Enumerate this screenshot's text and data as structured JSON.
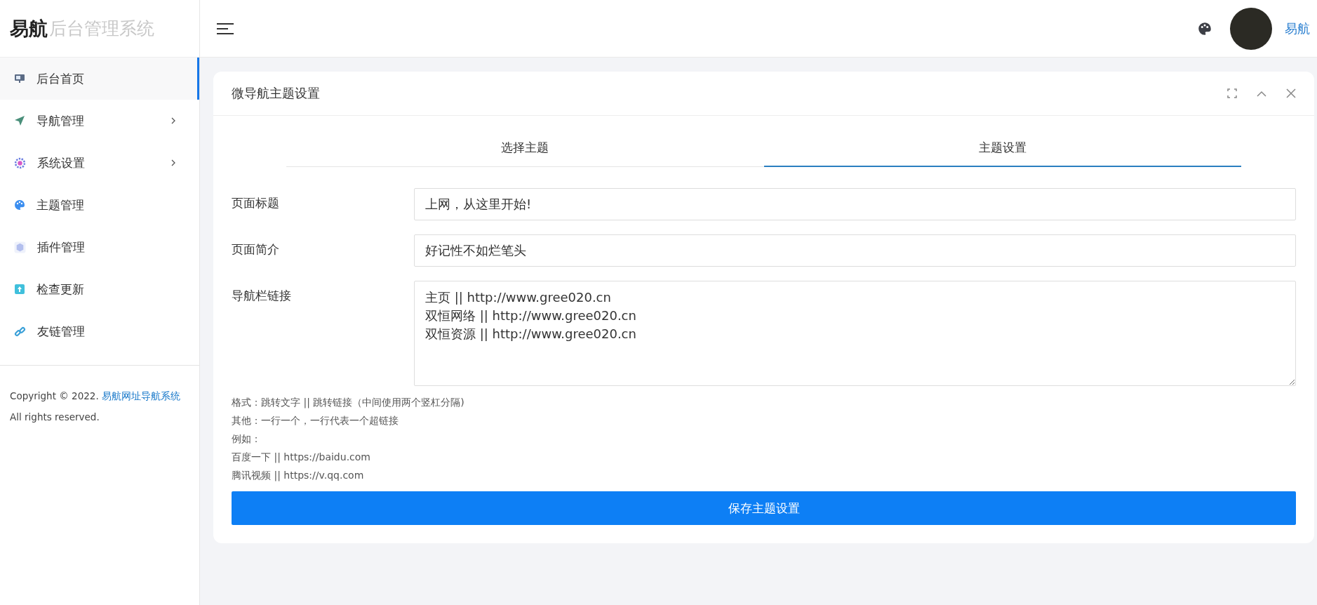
{
  "brand": {
    "name": "易航",
    "subtitle": "后台管理系统"
  },
  "sidebar": {
    "items": [
      {
        "label": "后台首页",
        "kind": "monitor",
        "selected": true,
        "has_submenu": false
      },
      {
        "label": "导航管理",
        "kind": "plane",
        "selected": false,
        "has_submenu": true
      },
      {
        "label": "系统设置",
        "kind": "gear",
        "selected": false,
        "has_submenu": true
      },
      {
        "label": "主题管理",
        "kind": "palette",
        "selected": false,
        "has_submenu": false
      },
      {
        "label": "插件管理",
        "kind": "plugin",
        "selected": false,
        "has_submenu": false
      },
      {
        "label": "检查更新",
        "kind": "update",
        "selected": false,
        "has_submenu": false
      },
      {
        "label": "友链管理",
        "kind": "link",
        "selected": false,
        "has_submenu": false
      }
    ],
    "footer": {
      "before": "Copyright © 2022. ",
      "link": "易航网址导航系统",
      "after": " All rights reserved."
    }
  },
  "header": {
    "user": "易航"
  },
  "panel": {
    "title": "微导航主题设置",
    "tabs": [
      {
        "label": "选择主题",
        "selected": false
      },
      {
        "label": "主题设置",
        "selected": true
      }
    ],
    "fields": [
      {
        "label": "页面标题",
        "kind": "input",
        "value": "上网，从这里开始!"
      },
      {
        "label": "页面简介",
        "kind": "input",
        "value": "好记性不如烂笔头"
      },
      {
        "label": "导航栏链接",
        "kind": "textarea",
        "value": "主页 || http://www.gree020.cn\n双恒网络 || http://www.gree020.cn\n双恒资源 || http://www.gree020.cn"
      }
    ],
    "help": [
      "格式：跳转文字 || 跳转链接（中间使用两个竖杠分隔)",
      "其他：一行一个，一行代表一个超链接",
      "例如：",
      "百度一下 || https://baidu.com",
      "腾讯视频 || https://v.qq.com"
    ],
    "save_button": "保存主题设置"
  }
}
